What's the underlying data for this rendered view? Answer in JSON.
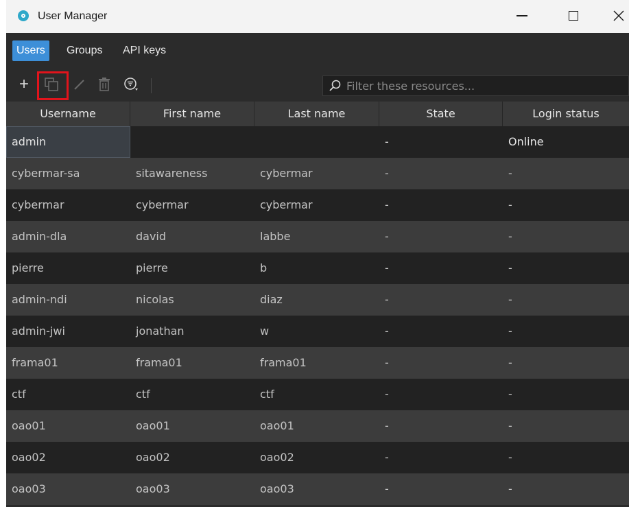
{
  "window": {
    "title": "User Manager"
  },
  "tabs": [
    {
      "label": "Users",
      "active": true
    },
    {
      "label": "Groups",
      "active": false
    },
    {
      "label": "API keys",
      "active": false
    }
  ],
  "toolbar": {
    "add_glyph": "+",
    "icons": [
      "plus-icon",
      "duplicate-icon",
      "pencil-icon",
      "trash-icon",
      "filter-icon"
    ],
    "highlight_color": "#e1141c"
  },
  "search": {
    "placeholder": "Filter these resources..."
  },
  "table": {
    "columns": [
      "Username",
      "First name",
      "Last name",
      "State",
      "Login status"
    ],
    "rows": [
      [
        "admin",
        "",
        "",
        "-",
        "Online"
      ],
      [
        "cybermar-sa",
        "sitawareness",
        "cybermar",
        "-",
        "-"
      ],
      [
        "cybermar",
        "cybermar",
        "cybermar",
        "-",
        "-"
      ],
      [
        "admin-dla",
        "david",
        "labbe",
        "-",
        "-"
      ],
      [
        "pierre",
        "pierre",
        "b",
        "-",
        "-"
      ],
      [
        "admin-ndi",
        "nicolas",
        "diaz",
        "-",
        "-"
      ],
      [
        "admin-jwi",
        "jonathan",
        "w",
        "-",
        "-"
      ],
      [
        "frama01",
        "frama01",
        "frama01",
        "-",
        "-"
      ],
      [
        "ctf",
        "ctf",
        "ctf",
        "-",
        "-"
      ],
      [
        "oao01",
        "oao01",
        "oao01",
        "-",
        "-"
      ],
      [
        "oao02",
        "oao02",
        "oao02",
        "-",
        "-"
      ],
      [
        "oao03",
        "oao03",
        "oao03",
        "-",
        "-"
      ]
    ]
  },
  "colors": {
    "accent": "#3d8fd8",
    "background": "#2b2b2b",
    "row_light": "#3c3c3c",
    "row_dark": "#222222"
  }
}
